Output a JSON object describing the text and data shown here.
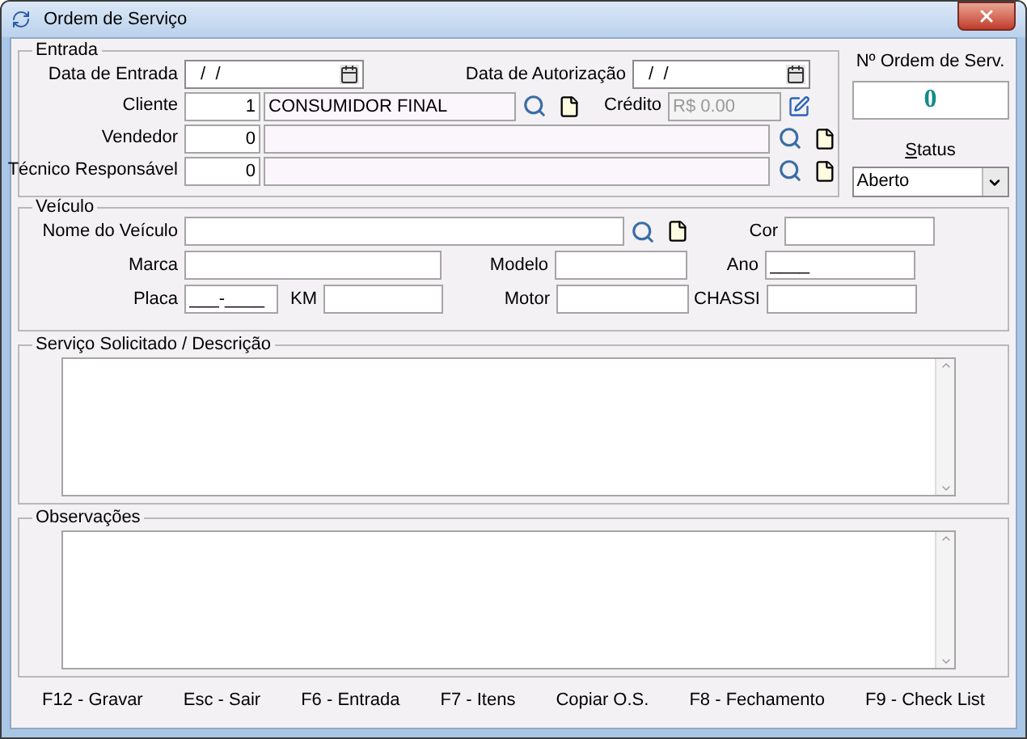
{
  "window": {
    "title": "Ordem de Serviço"
  },
  "entrada": {
    "legend": "Entrada",
    "data_entrada": {
      "label": "Data de Entrada",
      "value": " /  /"
    },
    "data_autorizacao": {
      "label": "Data de Autorização",
      "value": " /  /"
    },
    "cliente": {
      "label": "Cliente",
      "code": "1",
      "name": "CONSUMIDOR FINAL"
    },
    "credito": {
      "label": "Crédito",
      "value": "R$ 0.00",
      "disabled": true
    },
    "vendedor": {
      "label": "Vendedor",
      "code": "0"
    },
    "tecnico": {
      "label": "Técnico Responsável",
      "code": "0"
    }
  },
  "order_number": {
    "label": "Nº Ordem de Serv.",
    "value": "0"
  },
  "status": {
    "label": "Status",
    "value": "Aberto"
  },
  "veiculo": {
    "legend": "Veículo",
    "nome": {
      "label": "Nome do Veículo"
    },
    "cor": {
      "label": "Cor"
    },
    "marca": {
      "label": "Marca"
    },
    "modelo": {
      "label": "Modelo"
    },
    "ano": {
      "label": "Ano",
      "value": "____"
    },
    "placa": {
      "label": "Placa",
      "value": "___-____"
    },
    "km": {
      "label": "KM"
    },
    "motor": {
      "label": "Motor"
    },
    "chassi": {
      "label": "CHASSI"
    }
  },
  "servico": {
    "legend": "Serviço Solicitado / Descrição"
  },
  "observacoes": {
    "legend": "Observações"
  },
  "buttons": [
    "F12 - Gravar",
    "Esc - Sair",
    "F6 - Entrada",
    "F7 - Itens",
    "Copiar O.S.",
    "F8 - Fechamento",
    "F9 - Check List"
  ]
}
